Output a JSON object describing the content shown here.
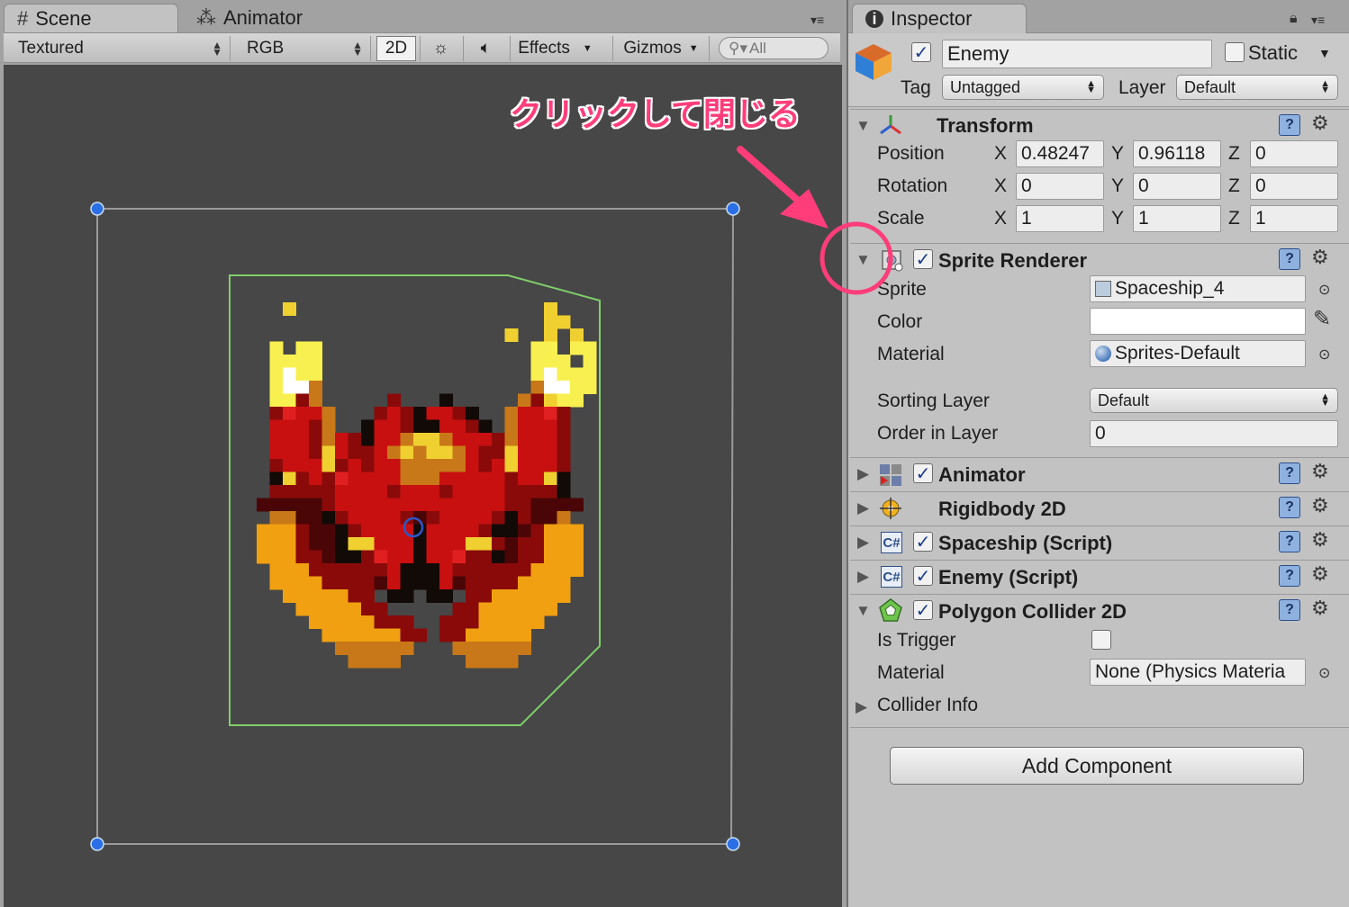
{
  "scene_panel": {
    "tabs": [
      {
        "label": "Scene",
        "icon": "hash-grid-icon",
        "active": true
      },
      {
        "label": "Animator",
        "icon": "animator-icon",
        "active": false
      }
    ],
    "toolbar": {
      "draw_mode": "Textured",
      "render_mode": "RGB",
      "mode_2d": "2D",
      "effects_label": "Effects",
      "gizmos_label": "Gizmos",
      "search_placeholder": "All"
    }
  },
  "inspector": {
    "tab_label": "Inspector",
    "object": {
      "name": "Enemy",
      "active": true,
      "static_label": "Static",
      "static": false,
      "tag_label": "Tag",
      "tag_value": "Untagged",
      "layer_label": "Layer",
      "layer_value": "Default"
    },
    "transform": {
      "title": "Transform",
      "rows": [
        {
          "label": "Position",
          "x": "0.48247",
          "y": "0.96118",
          "z": "0"
        },
        {
          "label": "Rotation",
          "x": "0",
          "y": "0",
          "z": "0"
        },
        {
          "label": "Scale",
          "x": "1",
          "y": "1",
          "z": "1"
        }
      ],
      "axis_x": "X",
      "axis_y": "Y",
      "axis_z": "Z"
    },
    "sprite_renderer": {
      "title": "Sprite Renderer",
      "enabled": true,
      "sprite_label": "Sprite",
      "sprite_value": "Spaceship_4",
      "color_label": "Color",
      "color_value": "#ffffff",
      "material_label": "Material",
      "material_value": "Sprites-Default",
      "sorting_layer_label": "Sorting Layer",
      "sorting_layer_value": "Default",
      "order_label": "Order in Layer",
      "order_value": "0"
    },
    "components": [
      {
        "title": "Animator",
        "enabled": true,
        "has_checkbox": true
      },
      {
        "title": "Rigidbody 2D",
        "has_checkbox": false
      },
      {
        "title": "Spaceship (Script)",
        "enabled": true,
        "has_checkbox": true
      },
      {
        "title": "Enemy (Script)",
        "enabled": true,
        "has_checkbox": true
      }
    ],
    "polygon_collider": {
      "title": "Polygon Collider 2D",
      "enabled": true,
      "is_trigger_label": "Is Trigger",
      "is_trigger": false,
      "material_label": "Material",
      "material_value": "None (Physics Materia",
      "collider_info_label": "Collider Info"
    },
    "add_component_label": "Add Component"
  },
  "annotation": {
    "text": "クリックして閉じる",
    "color": "#ff3d7a"
  }
}
